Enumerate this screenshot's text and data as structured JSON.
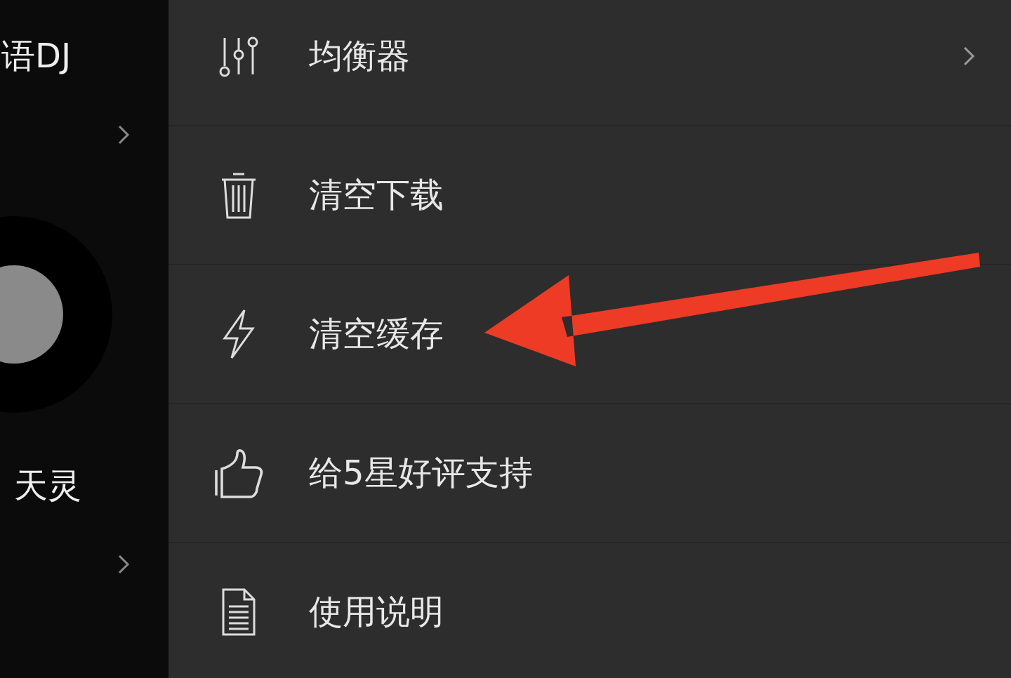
{
  "side_panel": {
    "items": [
      {
        "title": "语DJ"
      },
      {
        "title": "天灵"
      }
    ]
  },
  "menu": {
    "items": [
      {
        "kind": "equalizer",
        "label": "均衡器",
        "chevron": true
      },
      {
        "kind": "trash",
        "label": "清空下载",
        "chevron": false
      },
      {
        "kind": "bolt",
        "label": "清空缓存",
        "chevron": false
      },
      {
        "kind": "thumb",
        "label": "给5星好评支持",
        "chevron": false
      },
      {
        "kind": "doc",
        "label": "使用说明",
        "chevron": false
      }
    ]
  }
}
